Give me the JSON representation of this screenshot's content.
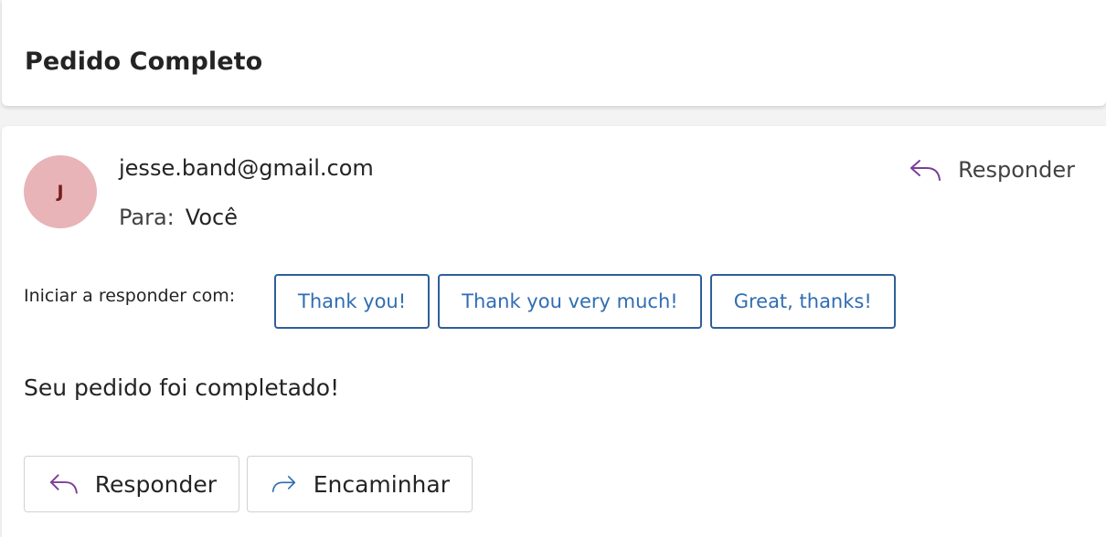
{
  "subject": {
    "title": "Pedido Completo"
  },
  "message": {
    "avatar": {
      "initial": "J",
      "bg_color": "#e8b4b8",
      "text_color": "#751d1f"
    },
    "sender": "jesse.band@gmail.com",
    "to_label": "Para:",
    "to_value": "Você",
    "reply_top_label": "Responder",
    "reply_icon": "reply-arrow-icon",
    "suggestions_label": "Iniciar a responder com:",
    "suggestions": [
      "Thank you!",
      "Thank you very much!",
      "Great, thanks!"
    ],
    "body": "Seu pedido foi completado!",
    "actions": {
      "reply_label": "Responder",
      "reply_icon": "reply-arrow-icon",
      "forward_label": "Encaminhar",
      "forward_icon": "forward-arrow-icon"
    }
  },
  "colors": {
    "reply_icon": "#7b3f98",
    "forward_icon": "#2f6db3",
    "suggestion": "#2f6db3"
  }
}
